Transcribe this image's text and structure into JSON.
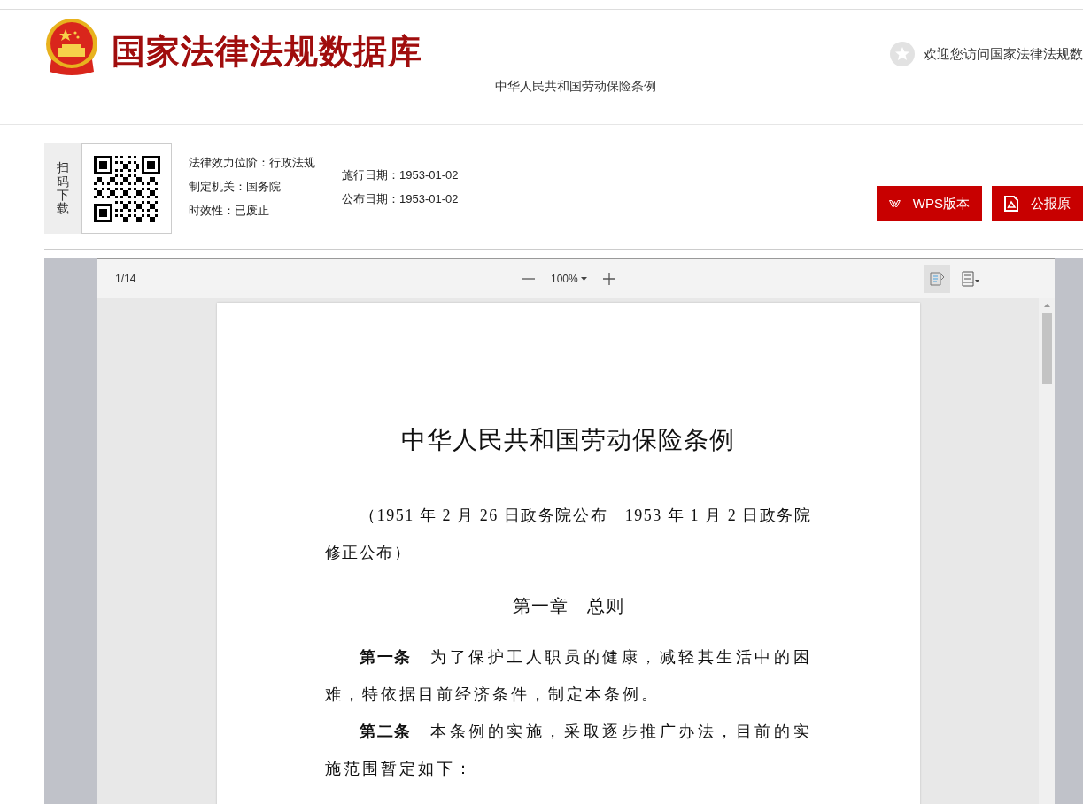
{
  "header": {
    "site_title": "国家法律法规数据库",
    "welcome": "欢迎您访问国家法律法规数",
    "document_title": "中华人民共和国劳动保险条例"
  },
  "info": {
    "scan_label": "扫码下载",
    "meta_left": [
      "法律效力位阶：行政法规",
      "制定机关：国务院",
      "时效性：已废止"
    ],
    "meta_right": [
      "施行日期：1953-01-02",
      "公布日期：1953-01-02"
    ],
    "buttons": [
      {
        "kind": "wps",
        "label": "WPS版本"
      },
      {
        "kind": "pdf",
        "label": "公报原"
      }
    ]
  },
  "viewer": {
    "page_indicator": "1/14",
    "zoom": "100%",
    "view_modes": [
      {
        "kind": "reading",
        "selected": true
      },
      {
        "kind": "page",
        "selected": false
      }
    ],
    "document": {
      "title": "中华人民共和国劳动保险条例",
      "blocks": [
        {
          "kind": "note",
          "text": "（1951 年 2 月 26 日政务院公布　1953 年 1 月 2 日政务院修正公布）"
        },
        {
          "kind": "chapter",
          "text": "第一章　总则"
        },
        {
          "kind": "article",
          "text": "**第一条**　为了保护工人职员的健康，减轻其生活中的困难，特依据目前经济条件，制定本条例。"
        },
        {
          "kind": "article",
          "text": "**第二条**　本条例的实施，采取逐步推广办法，目前的实施范围暂定如下："
        }
      ]
    }
  }
}
